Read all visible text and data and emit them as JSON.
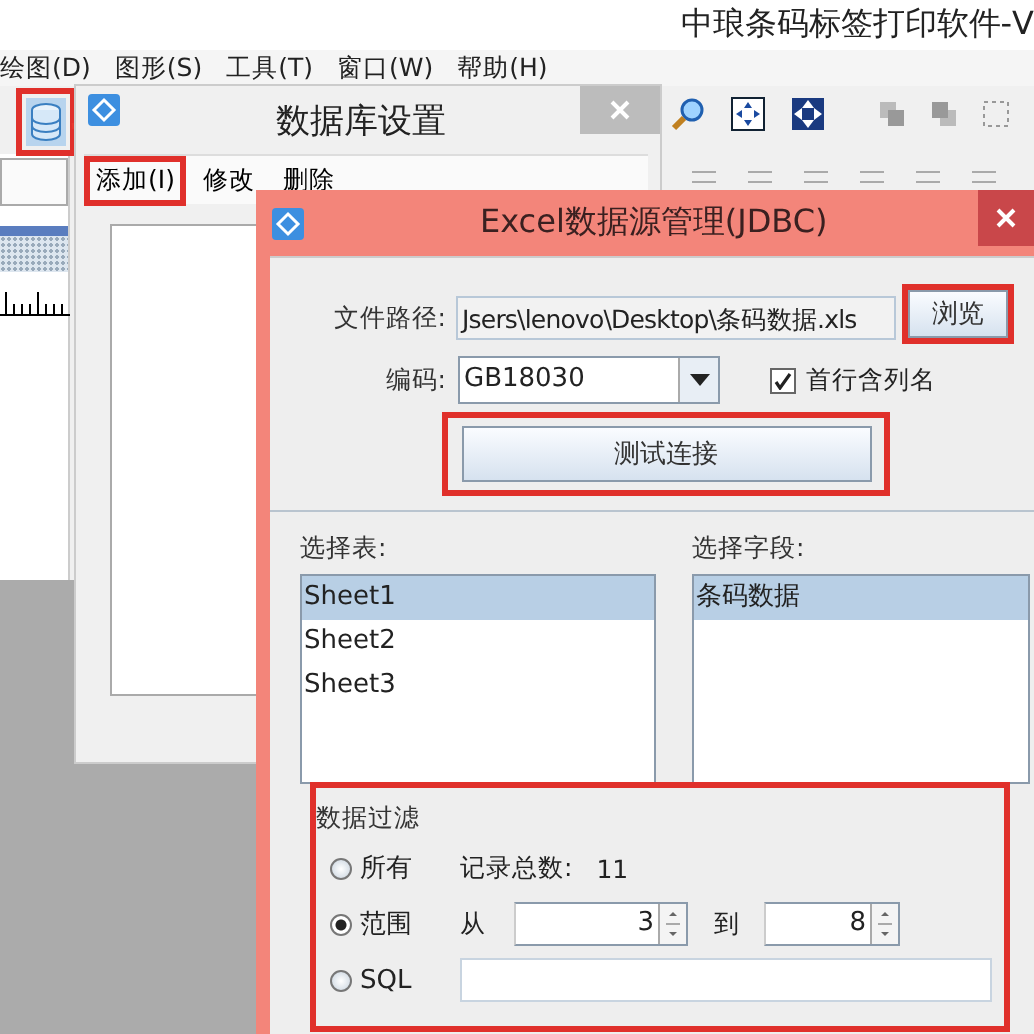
{
  "app_title": "中琅条码标签打印软件-V",
  "menu": [
    "绘图(D)",
    "图形(S)",
    "工具(T)",
    "窗口(W)",
    "帮助(H)"
  ],
  "database_button": {
    "highlighted": true
  },
  "db_dialog": {
    "title": "数据库设置",
    "toolbar": [
      {
        "label": "添加(I)",
        "highlighted": true
      },
      {
        "label": "修改",
        "highlighted": false
      },
      {
        "label": "删除",
        "highlighted": false
      }
    ]
  },
  "excel_dialog": {
    "title": "Excel数据源管理(JDBC)",
    "file_path": {
      "label": "文件路径:",
      "value": "Jsers\\lenovo\\Desktop\\条码数据.xls"
    },
    "browse_button": {
      "label": "浏览",
      "highlighted": true
    },
    "encoding": {
      "label": "编码:",
      "value": "GB18030"
    },
    "header_checkbox": {
      "label": "首行含列名",
      "checked": true
    },
    "test_button": {
      "label": "测试连接",
      "highlighted": true
    },
    "tables": {
      "label": "选择表:",
      "items": [
        {
          "label": "Sheet1",
          "selected": true
        },
        {
          "label": "Sheet2",
          "selected": false
        },
        {
          "label": "Sheet3",
          "selected": false
        }
      ]
    },
    "fields": {
      "label": "选择字段:",
      "items": [
        {
          "label": "条码数据",
          "selected": true
        }
      ]
    },
    "filter": {
      "title": "数据过滤",
      "highlighted": true,
      "options": [
        {
          "kind": "all",
          "label": "所有",
          "selected": false
        },
        {
          "kind": "range",
          "label": "范围",
          "selected": true
        },
        {
          "kind": "sql",
          "label": "SQL",
          "selected": false
        }
      ],
      "record_count_label": "记录总数:",
      "record_count": "11",
      "from_label": "从",
      "from": "3",
      "to_label": "到",
      "to": "8"
    }
  }
}
